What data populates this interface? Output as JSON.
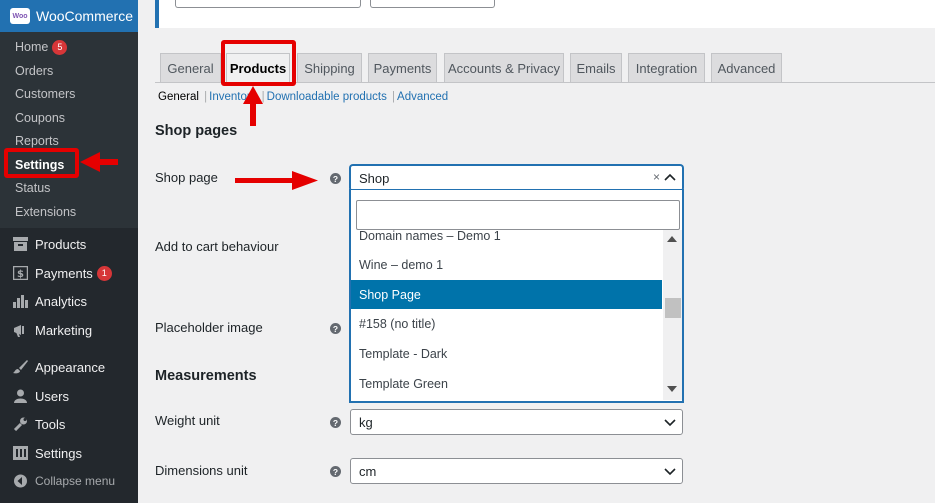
{
  "sidebar": {
    "brand": "WooCommerce",
    "brand_logo": "Woo",
    "submenu": [
      {
        "label": "Home",
        "badge": "5"
      },
      {
        "label": "Orders"
      },
      {
        "label": "Customers"
      },
      {
        "label": "Coupons"
      },
      {
        "label": "Reports"
      },
      {
        "label": "Settings",
        "current": true
      },
      {
        "label": "Status"
      },
      {
        "label": "Extensions"
      }
    ],
    "menu": [
      {
        "label": "Products",
        "icon": "archive-icon"
      },
      {
        "label": "Payments",
        "icon": "dollar-icon",
        "badge": "1"
      },
      {
        "label": "Analytics",
        "icon": "bar-chart-icon"
      },
      {
        "label": "Marketing",
        "icon": "megaphone-icon"
      },
      {
        "label": "Appearance",
        "icon": "paintbrush-icon"
      },
      {
        "label": "Users",
        "icon": "user-icon"
      },
      {
        "label": "Tools",
        "icon": "wrench-icon"
      },
      {
        "label": "Settings",
        "icon": "sliders-icon"
      },
      {
        "label": "Collapse menu",
        "icon": "collapse-icon"
      }
    ]
  },
  "tabs": [
    "General",
    "Products",
    "Shipping",
    "Payments",
    "Accounts & Privacy",
    "Emails",
    "Integration",
    "Advanced"
  ],
  "active_tab": "Products",
  "subsections": {
    "current": "General",
    "links": [
      "Inventory",
      "Downloadable products",
      "Advanced"
    ],
    "separator": "|"
  },
  "sections": {
    "shop_pages": "Shop pages",
    "measurements": "Measurements"
  },
  "fields": {
    "shop_page": {
      "label": "Shop page",
      "value": "Shop",
      "clear": "×"
    },
    "add_to_cart": {
      "label": "Add to cart behaviour"
    },
    "placeholder_image": {
      "label": "Placeholder image"
    },
    "weight_unit": {
      "label": "Weight unit",
      "value": "kg"
    },
    "dimensions_unit": {
      "label": "Dimensions unit",
      "value": "cm"
    },
    "help_glyph": "?"
  },
  "dropdown": {
    "search_value": "",
    "options": [
      "Domain names – Demo 1",
      "Wine – demo 1",
      "Shop Page",
      "#158 (no title)",
      "Template - Dark",
      "Template Green"
    ],
    "highlighted": "Shop Page"
  },
  "colors": {
    "accent": "#2271b1",
    "highlight": "#0073aa",
    "annotation_red": "#e50000",
    "sidebar_bg": "#23282d"
  }
}
